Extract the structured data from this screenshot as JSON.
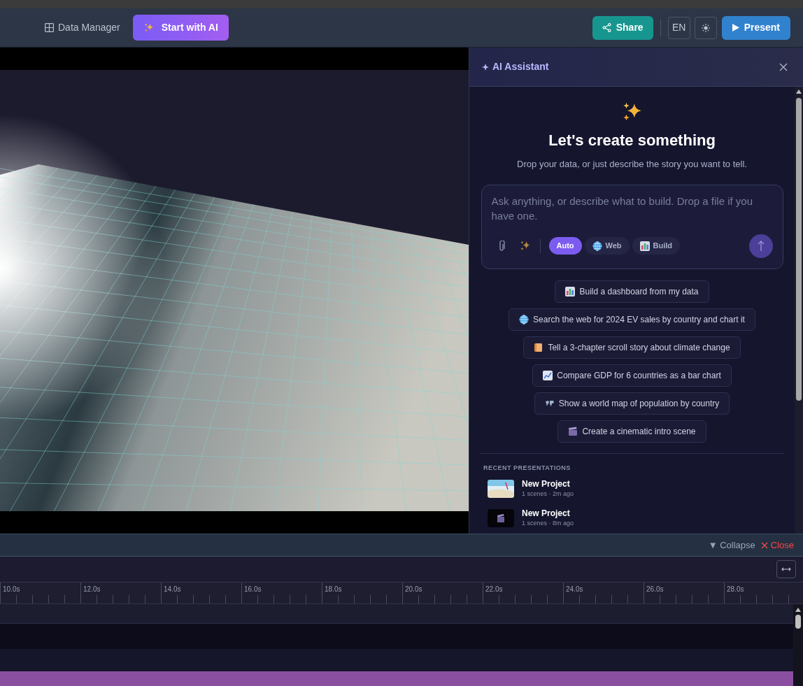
{
  "header": {
    "data_manager": "Data Manager",
    "start_ai": "Start with AI",
    "share": "Share",
    "language": "EN",
    "present": "Present"
  },
  "assistant": {
    "title": "AI Assistant",
    "heading": "Let's create something",
    "subtitle": "Drop your data, or just describe the story you want to tell.",
    "prompt": {
      "placeholder": "Ask anything, or describe what to build. Drop a file if you have one."
    },
    "modes": [
      {
        "label": "Auto",
        "kind": "auto",
        "selected": true
      },
      {
        "label": "Web",
        "kind": "globe",
        "selected": false
      },
      {
        "label": "Build",
        "kind": "chart",
        "selected": false
      }
    ],
    "suggestions": [
      {
        "kind": "chart",
        "text": "Build a dashboard from my data"
      },
      {
        "kind": "globe",
        "text": "Search the web for 2024 EV sales by country and chart it"
      },
      {
        "kind": "scroll",
        "text": "Tell a 3-chapter scroll story about climate change"
      },
      {
        "kind": "trend",
        "text": "Compare GDP for 6 countries as a bar chart"
      },
      {
        "kind": "map",
        "text": "Show a world map of population by country"
      },
      {
        "kind": "clapper",
        "text": "Create a cinematic intro scene"
      }
    ],
    "recent_heading": "RECENT PRESENTATIONS",
    "recent": [
      {
        "kind": "beach",
        "title": "New Project",
        "meta": "1 scenes · 2m ago"
      },
      {
        "kind": "clapper",
        "title": "New Project",
        "meta": "1 scenes · 8m ago"
      }
    ]
  },
  "timeline": {
    "collapse": "▼ Collapse",
    "close": "Close",
    "ticks": [
      "10.0s",
      "12.0s",
      "14.0s",
      "16.0s",
      "18.0s",
      "20.0s",
      "22.0s",
      "24.0s",
      "26.0s",
      "28.0s"
    ]
  }
}
